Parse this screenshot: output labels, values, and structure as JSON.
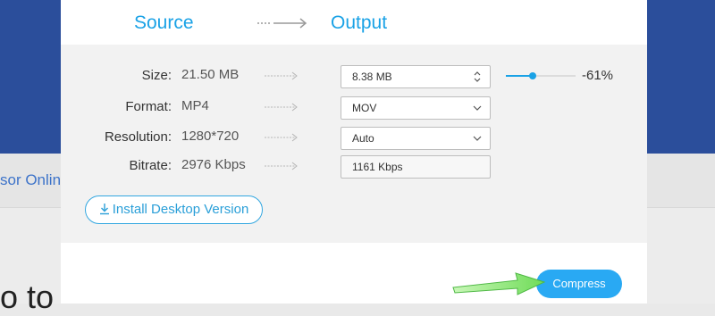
{
  "background": {
    "strip_text": "sor Onlin",
    "big_text": "o to"
  },
  "header": {
    "source_label": "Source",
    "output_label": "Output"
  },
  "rows": [
    {
      "label": "Size:",
      "value": "21.50 MB",
      "output": "8.38  MB",
      "control": "stepper"
    },
    {
      "label": "Format:",
      "value": "MP4",
      "output": "MOV",
      "control": "dropdown"
    },
    {
      "label": "Resolution:",
      "value": "1280*720",
      "output": "Auto",
      "control": "dropdown"
    },
    {
      "label": "Bitrate:",
      "value": "2976 Kbps",
      "output": "1161 Kbps",
      "control": "readonly"
    }
  ],
  "size_slider": {
    "level_fraction": 0.39,
    "percent_label": "-61%"
  },
  "buttons": {
    "install": "Install Desktop Version",
    "compress": "Compress"
  },
  "icons": {
    "install": "download-icon",
    "stepper": "up-down-caret-icon",
    "dropdown": "chevron-down-icon",
    "pointer": "green-arrow-icon"
  },
  "colors": {
    "accent": "#1aa2e6",
    "compress_button": "#29a9f3",
    "header_background": "#2b4e9b",
    "pointer_arrow": "#7fe36b"
  }
}
